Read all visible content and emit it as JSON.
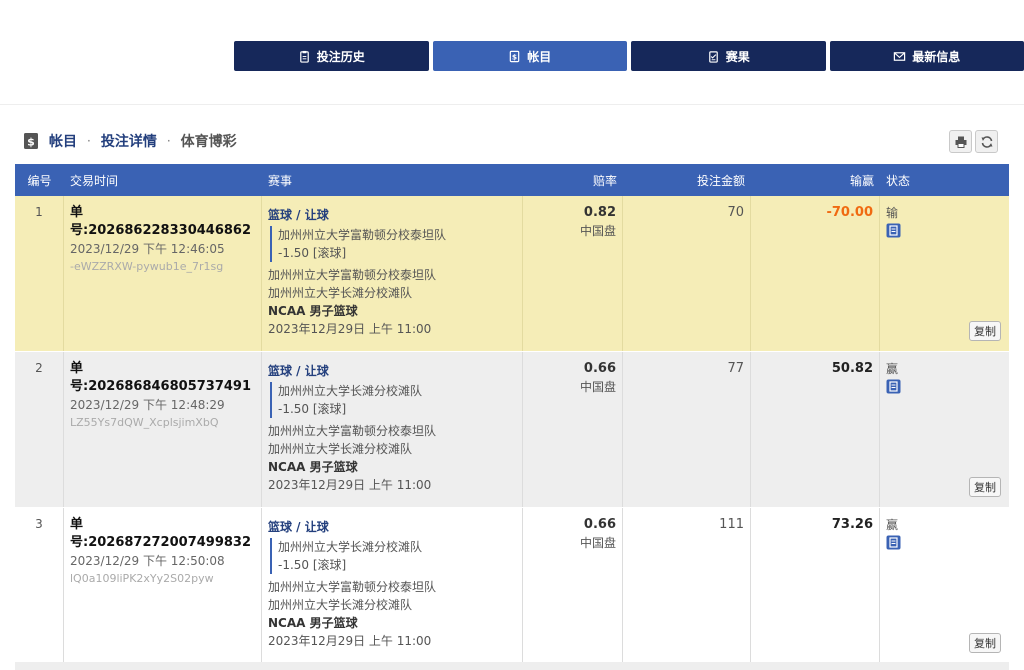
{
  "nav": {
    "tabs": [
      {
        "label": "投注历史",
        "icon": "clipboard-icon"
      },
      {
        "label": "帐目",
        "icon": "ledger-icon"
      },
      {
        "label": "赛果",
        "icon": "checklist-icon"
      },
      {
        "label": "最新信息",
        "icon": "mail-icon"
      }
    ],
    "active_index": 1
  },
  "breadcrumb": {
    "items": [
      "帐目",
      "投注详情",
      "体育博彩"
    ],
    "separator": "·"
  },
  "table": {
    "headers": [
      "编号",
      "交易时间",
      "赛事",
      "赔率",
      "投注金额",
      "输赢",
      "状态"
    ],
    "rows": [
      {
        "no": "1",
        "ticket": "单号:202686228330446862",
        "time": "2023/12/29 下午 12:46:05",
        "ref": "-eWZZRXW-pywub1e_7r1sg",
        "event_title": "篮球 / 让球",
        "pick_team": "加州州立大学富勒顿分校泰坦队",
        "pick_line": "-1.50 [滚球]",
        "home": "加州州立大学富勒顿分校泰坦队",
        "away": "加州州立大学长滩分校滩队",
        "league": "NCAA 男子篮球",
        "match_time": "2023年12月29日 上午 11:00",
        "odds": "0.82",
        "market": "中国盘",
        "amount": "70",
        "win": "-70.00",
        "status": "输",
        "copy": "复制"
      },
      {
        "no": "2",
        "ticket": "单号:202686846805737491",
        "time": "2023/12/29 下午 12:48:29",
        "ref": "LZ55Ys7dQW_XcplsjimXbQ",
        "event_title": "篮球 / 让球",
        "pick_team": "加州州立大学长滩分校滩队",
        "pick_line": "-1.50 [滚球]",
        "home": "加州州立大学富勒顿分校泰坦队",
        "away": "加州州立大学长滩分校滩队",
        "league": "NCAA 男子篮球",
        "match_time": "2023年12月29日 上午 11:00",
        "odds": "0.66",
        "market": "中国盘",
        "amount": "77",
        "win": "50.82",
        "status": "赢",
        "copy": "复制"
      },
      {
        "no": "3",
        "ticket": "单号:202687272007499832",
        "time": "2023/12/29 下午 12:50:08",
        "ref": "lQ0a109liPK2xYy2S02pyw",
        "event_title": "篮球 / 让球",
        "pick_team": "加州州立大学长滩分校滩队",
        "pick_line": "-1.50 [滚球]",
        "home": "加州州立大学富勒顿分校泰坦队",
        "away": "加州州立大学长滩分校滩队",
        "league": "NCAA 男子篮球",
        "match_time": "2023年12月29日 上午 11:00",
        "odds": "0.66",
        "market": "中国盘",
        "amount": "111",
        "win": "73.26",
        "status": "赢",
        "copy": "复制"
      }
    ]
  },
  "colors": {
    "nav_dark": "#16285a",
    "nav_active": "#3a62b4",
    "loss": "#f06a11",
    "row_highlight": "#f5edb7"
  }
}
